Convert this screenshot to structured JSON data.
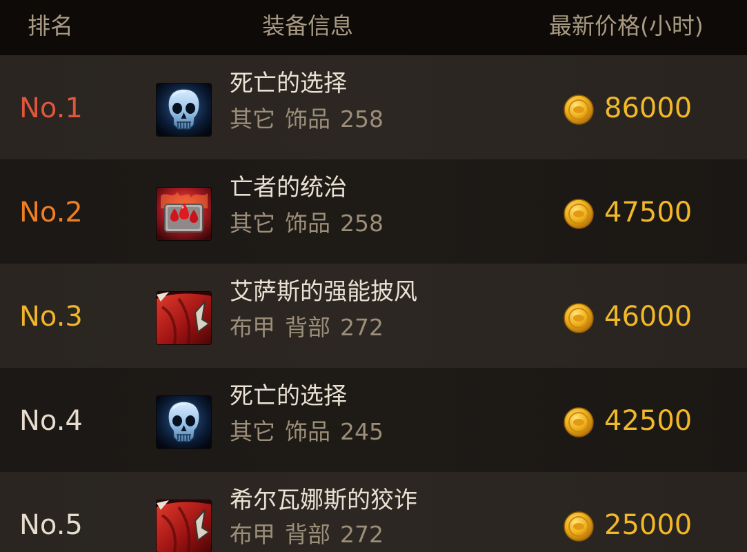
{
  "header": {
    "rank_label": "排名",
    "info_label": "装备信息",
    "price_label": "最新价格(小时)"
  },
  "colors": {
    "rank_1": "#e0553c",
    "rank_2": "#ef7f22",
    "rank_3": "#f2b52a",
    "rank_other": "#e6ddce",
    "price": "#f1b827"
  },
  "rows": [
    {
      "rank": "No.1",
      "icon": "skull-icon",
      "name": "死亡的选择",
      "type": "其它",
      "slot": "饰品",
      "level": "258",
      "price": "86000"
    },
    {
      "rank": "No.2",
      "icon": "red-gem-icon",
      "name": "亡者的统治",
      "type": "其它",
      "slot": "饰品",
      "level": "258",
      "price": "47500"
    },
    {
      "rank": "No.3",
      "icon": "red-cloak-icon",
      "name": "艾萨斯的强能披风",
      "type": "布甲",
      "slot": "背部",
      "level": "272",
      "price": "46000"
    },
    {
      "rank": "No.4",
      "icon": "skull-icon",
      "name": "死亡的选择",
      "type": "其它",
      "slot": "饰品",
      "level": "245",
      "price": "42500"
    },
    {
      "rank": "No.5",
      "icon": "red-cloak-icon",
      "name": "希尔瓦娜斯的狡诈",
      "type": "布甲",
      "slot": "背部",
      "level": "272",
      "price": "25000"
    }
  ]
}
